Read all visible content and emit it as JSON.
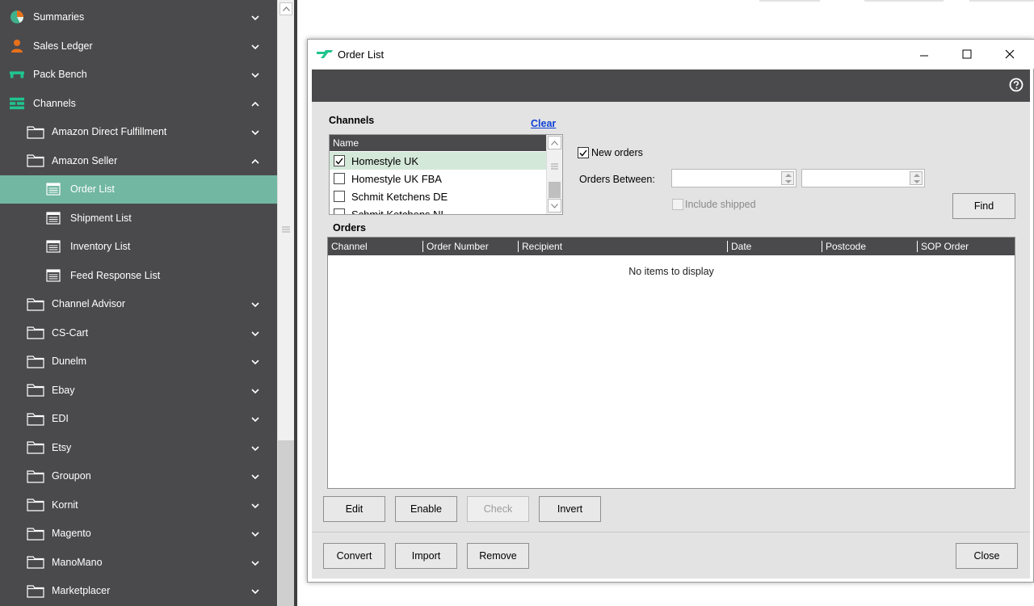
{
  "sidebar": {
    "items": [
      {
        "label": "Summaries",
        "icon": "pie-chart-icon",
        "level": 0,
        "expanded": false
      },
      {
        "label": "Sales Ledger",
        "icon": "person-icon",
        "level": 0,
        "expanded": false
      },
      {
        "label": "Pack Bench",
        "icon": "bench-icon",
        "level": 0,
        "expanded": false
      },
      {
        "label": "Channels",
        "icon": "channels-icon",
        "level": 0,
        "expanded": true
      },
      {
        "label": "Amazon Direct Fulfillment",
        "icon": "folder-icon",
        "level": 1,
        "expanded": false
      },
      {
        "label": "Amazon Seller",
        "icon": "folder-icon",
        "level": 1,
        "expanded": true
      },
      {
        "label": "Order List",
        "icon": "list-icon",
        "level": 2,
        "active": true
      },
      {
        "label": "Shipment List",
        "icon": "list-icon",
        "level": 2
      },
      {
        "label": "Inventory List",
        "icon": "list-icon",
        "level": 2
      },
      {
        "label": "Feed Response List",
        "icon": "list-icon",
        "level": 2
      },
      {
        "label": "Channel Advisor",
        "icon": "folder-icon",
        "level": 1,
        "expanded": false
      },
      {
        "label": "CS-Cart",
        "icon": "folder-icon",
        "level": 1,
        "expanded": false
      },
      {
        "label": "Dunelm",
        "icon": "folder-icon",
        "level": 1,
        "expanded": false
      },
      {
        "label": "Ebay",
        "icon": "folder-icon",
        "level": 1,
        "expanded": false
      },
      {
        "label": "EDI",
        "icon": "folder-icon",
        "level": 1,
        "expanded": false
      },
      {
        "label": "Etsy",
        "icon": "folder-icon",
        "level": 1,
        "expanded": false
      },
      {
        "label": "Groupon",
        "icon": "folder-icon",
        "level": 1,
        "expanded": false
      },
      {
        "label": "Kornit",
        "icon": "folder-icon",
        "level": 1,
        "expanded": false
      },
      {
        "label": "Magento",
        "icon": "folder-icon",
        "level": 1,
        "expanded": false
      },
      {
        "label": "ManoMano",
        "icon": "folder-icon",
        "level": 1,
        "expanded": false
      },
      {
        "label": "Marketplacer",
        "icon": "folder-icon",
        "level": 1,
        "expanded": false
      }
    ]
  },
  "dialog": {
    "title": "Order List",
    "channels_title": "Channels",
    "clear_label": "Clear",
    "channels_header": "Name",
    "channels": [
      {
        "name": "Homestyle UK",
        "checked": true
      },
      {
        "name": "Homestyle UK FBA",
        "checked": false
      },
      {
        "name": "Schmit Ketchens DE",
        "checked": false
      },
      {
        "name": "Schmit Ketchens NL",
        "checked": false
      }
    ],
    "new_orders_label": "New orders",
    "new_orders_checked": true,
    "orders_between_label": "Orders Between:",
    "date_from": "",
    "date_to": "",
    "include_shipped_label": "Include shipped",
    "find_label": "Find",
    "orders_title": "Orders",
    "orders_columns": [
      "Channel",
      "Order Number",
      "Recipient",
      "Date",
      "Postcode",
      "SOP Order"
    ],
    "no_items_text": "No items to display",
    "buttons": {
      "edit": "Edit",
      "enable": "Enable",
      "check": "Check",
      "invert": "Invert",
      "convert": "Convert",
      "import": "Import",
      "remove": "Remove",
      "close": "Close"
    }
  },
  "colors": {
    "sidebar_bg": "#4a4a4c",
    "active_bg": "#72b7a2",
    "selected_row": "#d4e8d9",
    "link": "#0c3fd6",
    "summaries_icon": "#3fb08a",
    "sales_ledger_icon": "#e8701a",
    "brand_green": "#1fc48c"
  }
}
